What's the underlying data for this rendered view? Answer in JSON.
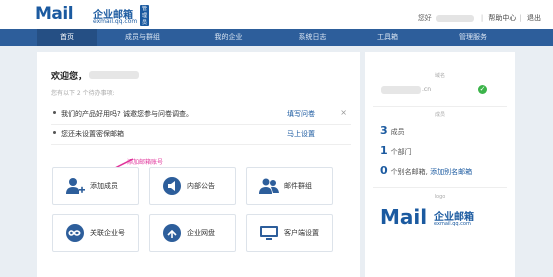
{
  "header": {
    "logo_text": "Mail",
    "logo_cn": "企业邮箱",
    "logo_sub": "exmail.qq.com",
    "logo_badge": "管理员",
    "user_prefix": "您好",
    "help_center": "帮助中心",
    "separator": "|",
    "logout": "退出"
  },
  "nav": {
    "items": [
      {
        "label": "首页"
      },
      {
        "label": "成员与群组"
      },
      {
        "label": "我的企业"
      },
      {
        "label": "系统日志"
      },
      {
        "label": "工具箱"
      },
      {
        "label": "管理服务"
      }
    ]
  },
  "main": {
    "welcome": "欢迎您，",
    "todo_hint": "您有以下 2 个待办事项:",
    "tasks": [
      {
        "text": "我们的产品好用吗? 诚邀您参与问卷调查。",
        "action": "填写问卷",
        "close": "×"
      },
      {
        "text": "您还未设置密保邮箱",
        "action": "马上设置",
        "close": ""
      }
    ],
    "annotation": "添加邮箱账号",
    "tiles": [
      {
        "label": "添加成员",
        "icon": "add-user-icon"
      },
      {
        "label": "内部公告",
        "icon": "announcement-icon"
      },
      {
        "label": "邮件群组",
        "icon": "group-icon"
      },
      {
        "label": "关联企业号",
        "icon": "link-icon"
      },
      {
        "label": "企业网盘",
        "icon": "cloud-icon"
      },
      {
        "label": "客户端设置",
        "icon": "client-icon"
      }
    ]
  },
  "side": {
    "domain_caption": "域名",
    "domain_suffix": ".cn",
    "members_caption": "成员",
    "members_count": "3",
    "members_unit": "成员",
    "dept_count": "1",
    "dept_unit": "个部门",
    "alias_count": "0",
    "alias_unit": "个别名邮箱,",
    "alias_link": "添加别名邮箱",
    "logo_caption": "logo",
    "logo_text": "Mail",
    "logo_cn": "企业邮箱",
    "logo_sub": "exmail.qq.com"
  },
  "colors": {
    "brand": "#1b5aa0",
    "nav": "#2d5e9b",
    "nav_active": "#254f84",
    "annotation": "#e0339a",
    "ok": "#3cb44a"
  }
}
